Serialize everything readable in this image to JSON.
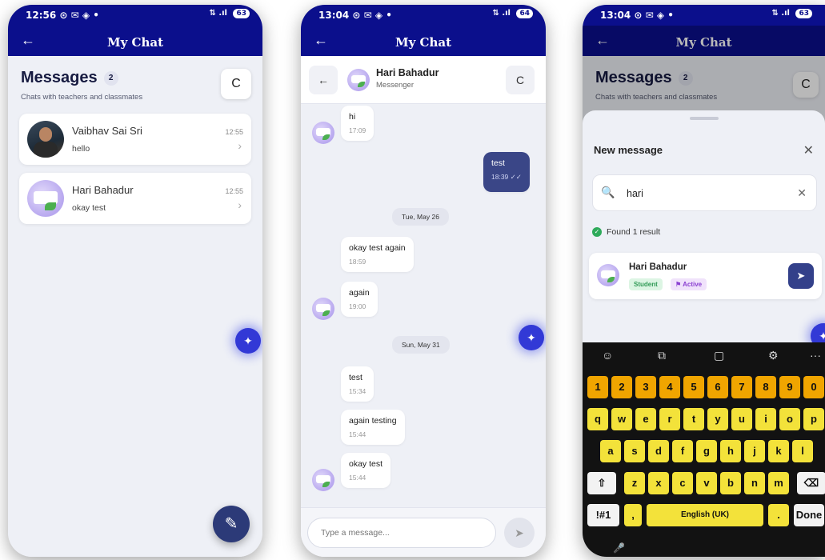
{
  "phones": [
    {
      "status": {
        "time": "12:56",
        "icons": "⊙ ✉ ◈ •",
        "right": "⇅ .ıl",
        "battery": "63"
      },
      "appbar": {
        "title": "My Chat"
      },
      "heading": "Messages",
      "count": "2",
      "subtitle": "Chats with teachers and classmates",
      "chats": [
        {
          "name": "Vaibhav Sai Sri",
          "preview": "hello",
          "time": "12:55"
        },
        {
          "name": "Hari Bahadur",
          "preview": "okay test",
          "time": "12:55"
        }
      ]
    },
    {
      "status": {
        "time": "13:04",
        "icons": "⊙ ✉ ◈ •",
        "right": "⇅ .ıl",
        "battery": "64"
      },
      "appbar": {
        "title": "My Chat"
      },
      "contact": {
        "name": "Hari Bahadur",
        "subtitle": "Messenger"
      },
      "messages": [
        {
          "text": "hi",
          "time": "17:09"
        },
        {
          "text": "test",
          "time": "18:39",
          "check": "✓✓"
        },
        {
          "text": "okay test again",
          "time": "18:59"
        },
        {
          "text": "again",
          "time": "19:00"
        },
        {
          "text": "test",
          "time": "15:34"
        },
        {
          "text": "again testing",
          "time": "15:44"
        },
        {
          "text": "okay test",
          "time": "15:44"
        }
      ],
      "dates": [
        "Tue, May 26",
        "Sun, May 31"
      ],
      "composer": {
        "placeholder": "Type a message..."
      }
    },
    {
      "status": {
        "time": "13:04",
        "icons": "⊙ ✉ ◈ •",
        "right": "⇅ .ıl",
        "battery": "63"
      },
      "appbar": {
        "title": "My Chat"
      },
      "heading": "Messages",
      "count": "2",
      "subtitle": "Chats with teachers and classmates",
      "sheet": {
        "title": "New message",
        "search_value": "hari",
        "found": "Found 1 result",
        "result": {
          "name": "Hari Bahadur",
          "tag1": "Student",
          "tag2": "Active"
        }
      },
      "keyboard": {
        "numbers": [
          "1",
          "2",
          "3",
          "4",
          "5",
          "6",
          "7",
          "8",
          "9",
          "0"
        ],
        "row1": [
          "q",
          "w",
          "e",
          "r",
          "t",
          "y",
          "u",
          "i",
          "o",
          "p"
        ],
        "row2": [
          "a",
          "s",
          "d",
          "f",
          "g",
          "h",
          "j",
          "k",
          "l"
        ],
        "row3": [
          "z",
          "x",
          "c",
          "v",
          "b",
          "n",
          "m"
        ],
        "symbols": "!#1",
        "comma": ",",
        "space": "English (UK)",
        "period": ".",
        "done": "Done"
      }
    }
  ],
  "icons": {
    "back": "←",
    "refresh": "C",
    "chevron": "›",
    "sparkle": "✦",
    "edit": "✎",
    "send": "➤",
    "search": "🔍",
    "close": "✕",
    "check": "✓",
    "shift": "⇧",
    "backspace": "⌫",
    "emoji": "☺",
    "sticker": "⧉",
    "clipboard": "▢",
    "settings": "⚙",
    "more": "···",
    "mic": "🎤",
    "flag": "⚑"
  },
  "colors": {
    "primary": "#0b0f8c",
    "bubble_out": "#3a4687",
    "fab": "#3239d6",
    "key": "#f3e23a",
    "key_num": "#f0a500"
  }
}
